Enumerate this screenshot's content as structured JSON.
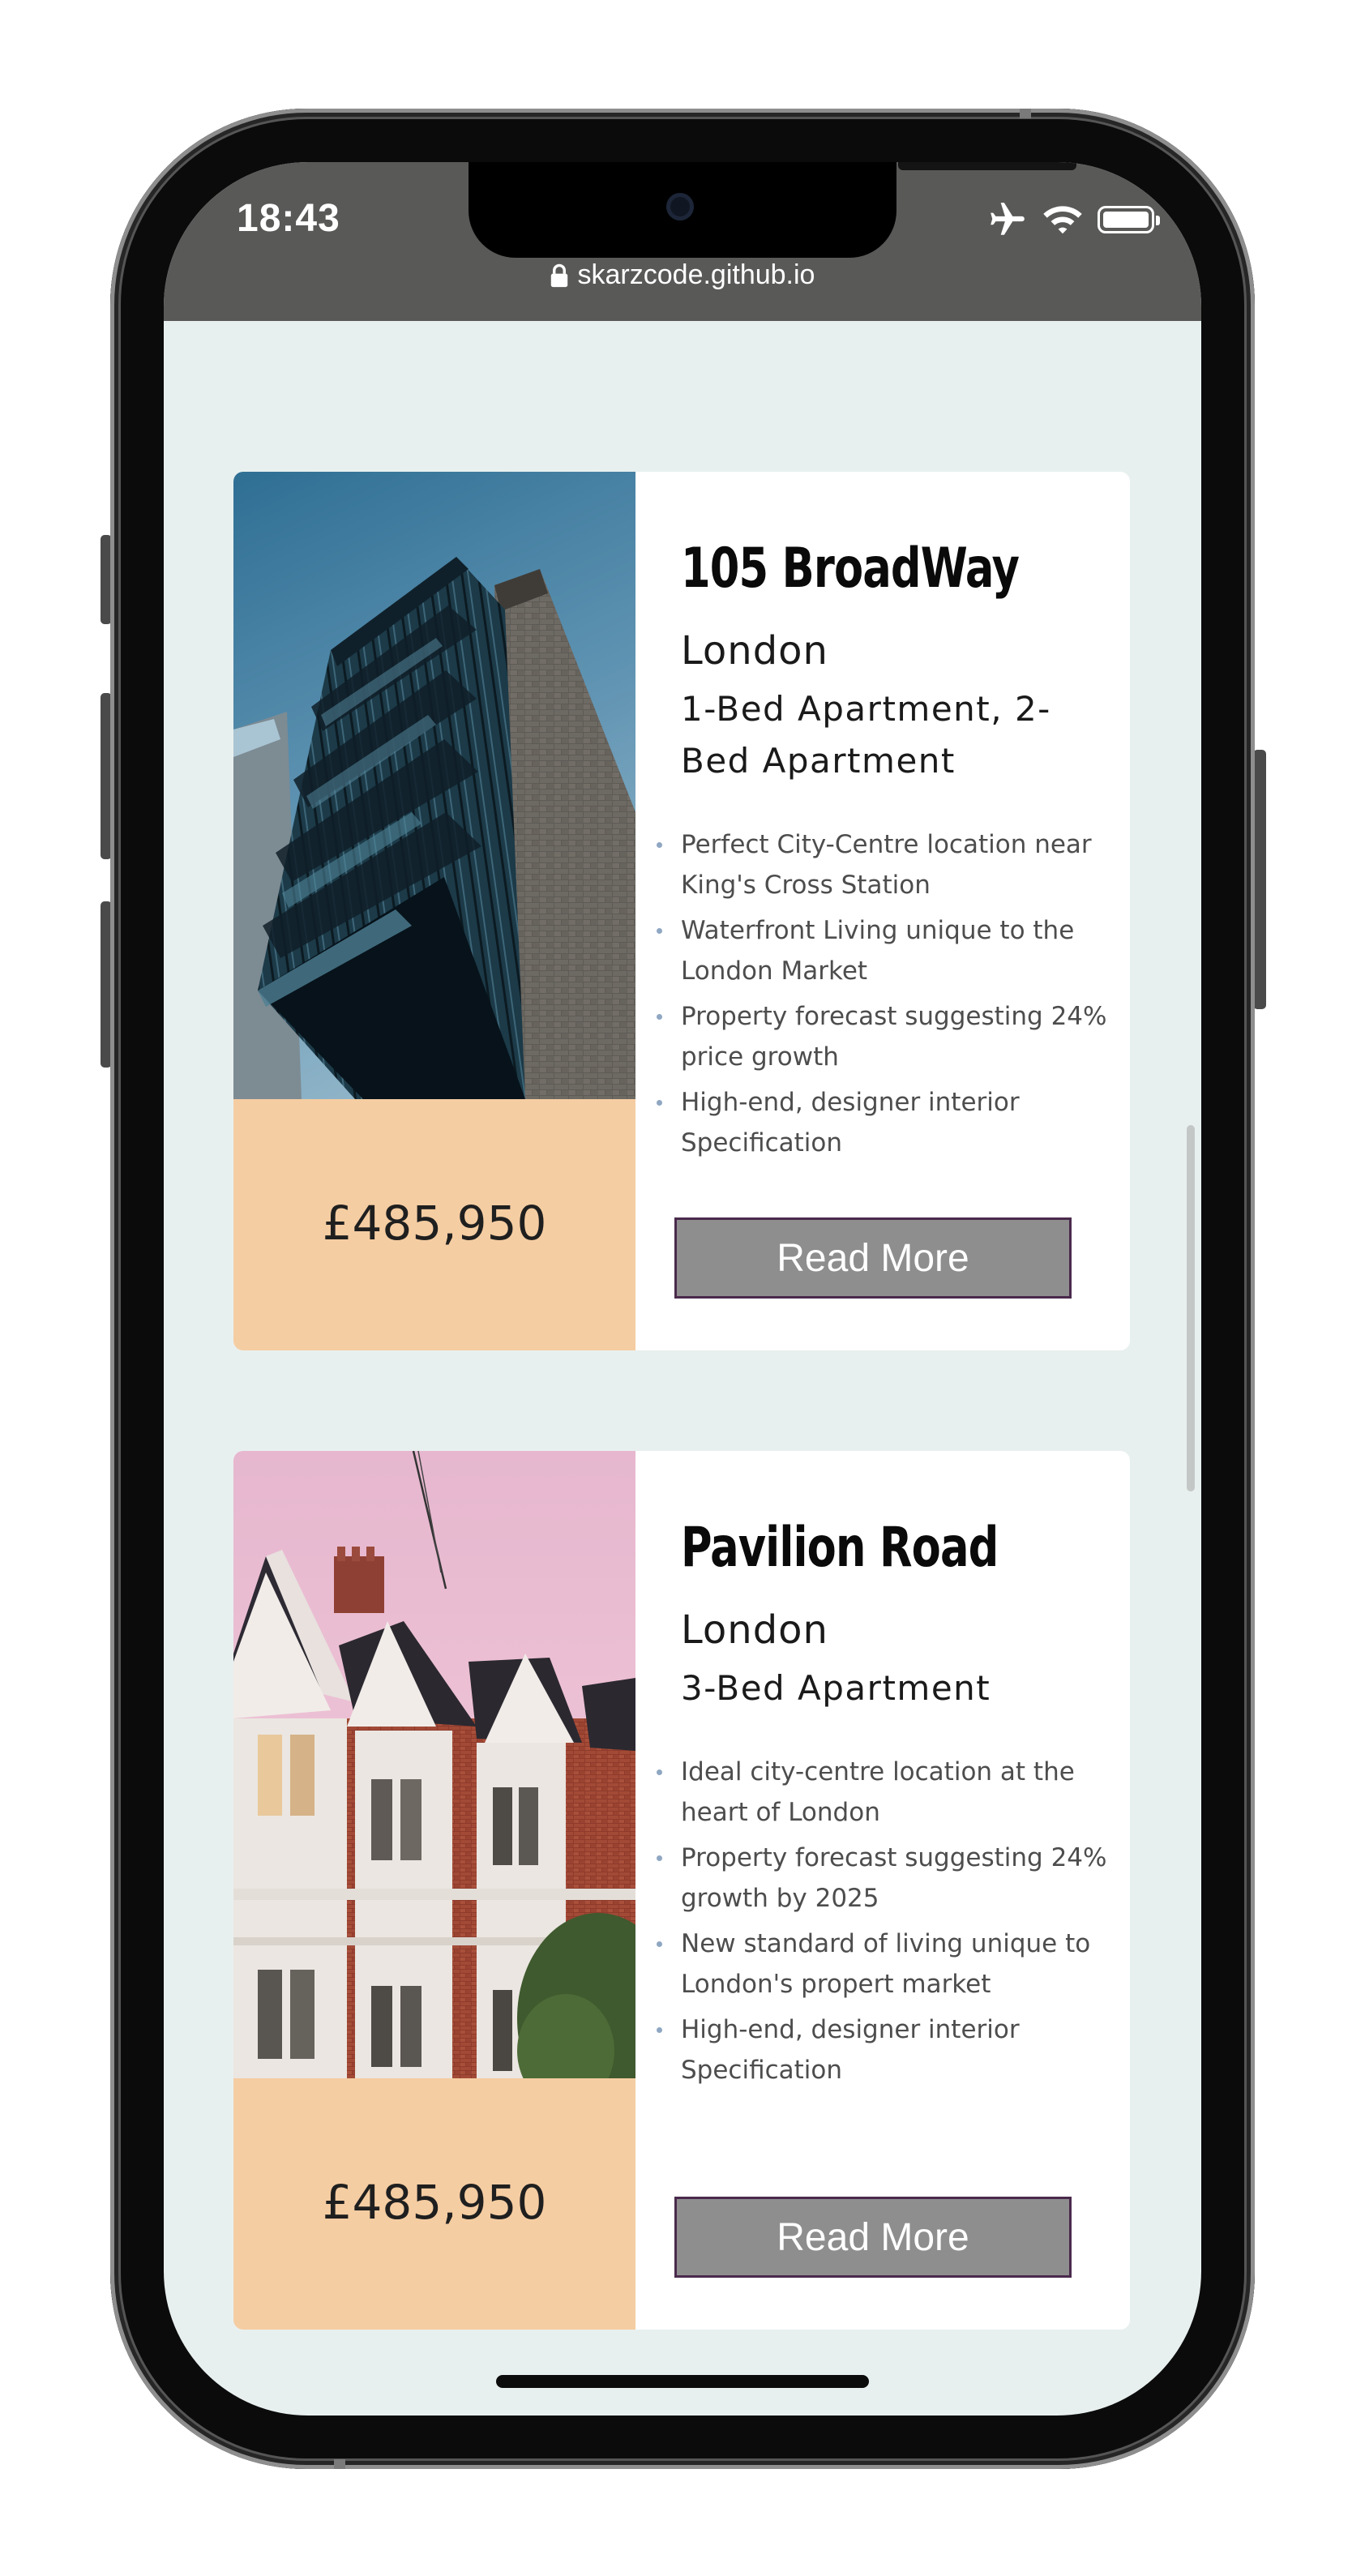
{
  "status_bar": {
    "time": "18:43",
    "icons": [
      "airplane-icon",
      "wifi-icon",
      "battery-icon"
    ]
  },
  "browser": {
    "url": "skarzcode.github.io",
    "lock_icon": "lock-icon"
  },
  "colors": {
    "page_background": "#e8f0ef",
    "price_box": "#f5cda2",
    "button_fill": "#8f8e8f",
    "button_border": "#4a2a4c",
    "bullet": "#8fa7c2"
  },
  "listings": [
    {
      "title": "105 BroadWay",
      "city": "London",
      "type": "1-Bed Apartment, 2-Bed Apartment",
      "features": [
        "Perfect City-Centre location near King's Cross Station",
        "Waterfront Living unique to the London Market",
        "Property forecast suggesting 24% price growth",
        "High-end, designer interior Specification"
      ],
      "price": "£485,950",
      "button_label": "Read More",
      "image": "tower-block-photo"
    },
    {
      "title": "Pavilion Road",
      "city": "London",
      "type": "3-Bed Apartment",
      "features": [
        "Ideal city-centre location at the heart of London",
        "Property forecast suggesting 24% growth by 2025",
        "New standard of living unique to London's propert market",
        "High-end, designer interior Specification"
      ],
      "price": "£485,950",
      "button_label": "Read More",
      "image": "terraced-houses-photo"
    }
  ]
}
